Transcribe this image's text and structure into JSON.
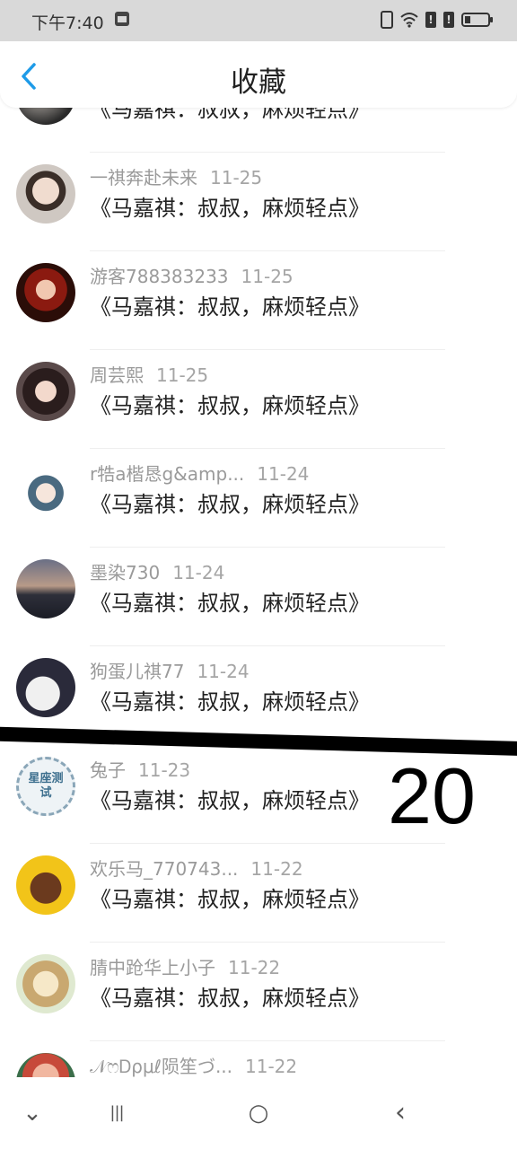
{
  "status_bar": {
    "time": "下午7:40",
    "signal_1": "!",
    "signal_2": "!"
  },
  "header": {
    "title": "收藏"
  },
  "items": [
    {
      "name": "",
      "date": "",
      "subtitle": "《马嘉祺：叔叔，麻烦轻点》"
    },
    {
      "name": "一祺奔赴未来",
      "date": "11-25",
      "subtitle": "《马嘉祺：叔叔，麻烦轻点》"
    },
    {
      "name": "游客788383233",
      "date": "11-25",
      "subtitle": "《马嘉祺：叔叔，麻烦轻点》"
    },
    {
      "name": "周芸熙",
      "date": "11-25",
      "subtitle": "《马嘉祺：叔叔，麻烦轻点》"
    },
    {
      "name": "r牿a楷恳g&amp...",
      "date": "11-24",
      "subtitle": "《马嘉祺：叔叔，麻烦轻点》"
    },
    {
      "name": "墨染730",
      "date": "11-24",
      "subtitle": "《马嘉祺：叔叔，麻烦轻点》"
    },
    {
      "name": "狗蛋儿祺77",
      "date": "11-24",
      "subtitle": "《马嘉祺：叔叔，麻烦轻点》"
    },
    {
      "name": "兔子",
      "date": "11-23",
      "subtitle": "《马嘉祺：叔叔，麻烦轻点》",
      "avatar_text": "星座测试"
    },
    {
      "name": "欢乐马_770743...",
      "date": "11-22",
      "subtitle": "《马嘉祺：叔叔，麻烦轻点》"
    },
    {
      "name": "腈中跄华上小子",
      "date": "11-22",
      "subtitle": "《马嘉祺：叔叔，麻烦轻点》"
    },
    {
      "name": "𝒩ෆᎠρμℓ陨笙づ...",
      "date": "11-22",
      "subtitle": ""
    }
  ],
  "overlay": {
    "number": "20"
  },
  "nav": {
    "down_glyph": "⌄",
    "menu_glyph": "|||",
    "home_glyph": "○",
    "back_glyph": "‹"
  },
  "colors": {
    "back_accent": "#1e9be8"
  }
}
